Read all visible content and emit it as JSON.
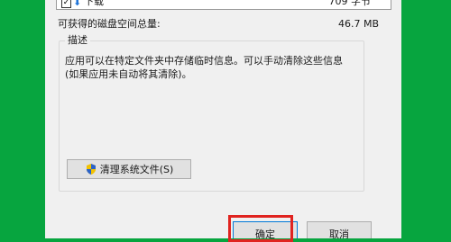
{
  "file_list": {
    "row": {
      "checked_mark": "✓",
      "icon": "download-arrow-icon",
      "name": "下载",
      "size": "709 字节"
    }
  },
  "space": {
    "label": "可获得的磁盘空间总量:",
    "value": "46.7 MB"
  },
  "description": {
    "title": "描述",
    "text": "应用可以在特定文件夹中存储临时信息。可以手动清除这些信息(如果应用未自动将其清除)。"
  },
  "buttons": {
    "cleanup_system_files": "清理系统文件(S)",
    "ok": "确定",
    "cancel": "取消"
  },
  "colors": {
    "background": "#07a53f",
    "dialog": "#f0f0f0",
    "highlight": "#e0231f"
  }
}
